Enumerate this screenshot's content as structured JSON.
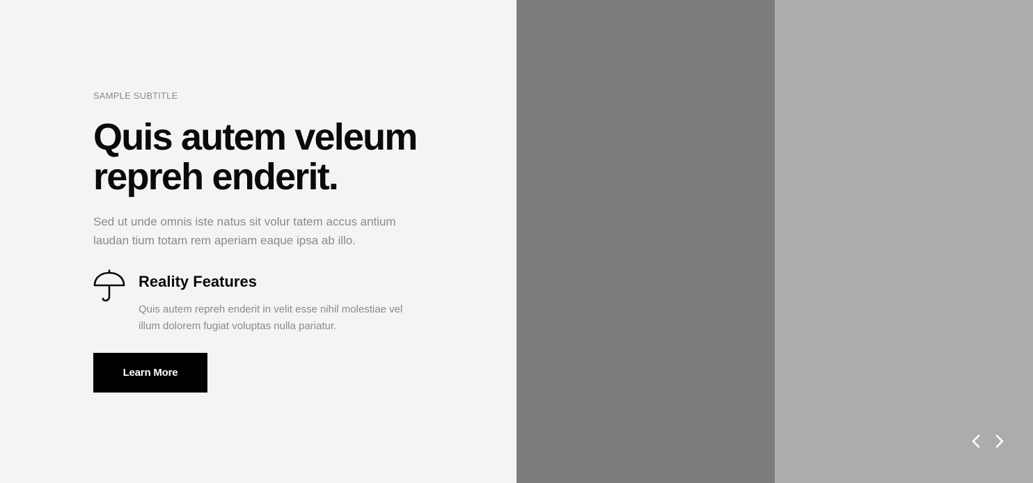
{
  "hero": {
    "subtitle": "SAMPLE SUBTITLE",
    "headline_line1": "Quis autem veleum",
    "headline_line2": "repreh enderit.",
    "description": "Sed ut unde omnis iste natus sit volur tatem accus antium laudan tium totam rem aperiam eaque ipsa ab illo."
  },
  "feature": {
    "icon": "umbrella-icon",
    "title": "Reality Features",
    "text": "Quis autem repreh enderit in velit esse nihil molestiae vel illum dolorem fugiat voluptas nulla pariatur."
  },
  "cta": {
    "label": "Learn More"
  },
  "slider": {
    "prev_icon": "chevron-left-icon",
    "next_icon": "chevron-right-icon"
  },
  "colors": {
    "background": "#f4f4f4",
    "heading": "#0a0a0a",
    "muted_text": "#8a8a8a",
    "button_bg": "#000000",
    "button_text": "#ffffff",
    "image_panel_dark": "#7b7c7e",
    "image_panel_light": "#acacae"
  }
}
